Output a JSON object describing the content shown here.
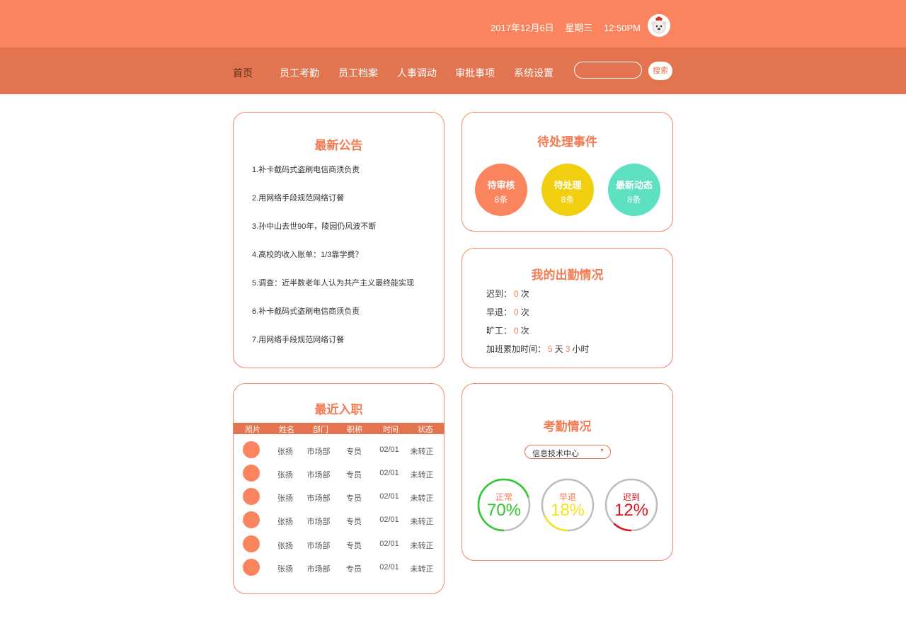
{
  "header": {
    "date": "2017年12月6日",
    "weekday": "星期三",
    "time": "12:50PM"
  },
  "nav": {
    "items": [
      "首页",
      "员工考勤",
      "员工档案",
      "人事调动",
      "审批事项",
      "系统设置"
    ],
    "search_label": "搜索"
  },
  "notices": {
    "title": "最新公告",
    "items": [
      "1.补卡截码式盗刷电信商须负责",
      "2.用网络手段规范网络订餐",
      "3.孙中山去世90年，陵园仍风波不断",
      "4.高校的收入账单：1/3靠学费？",
      "5.调查：近半数老年人认为共产主义最终能实现",
      "6.补卡截码式盗刷电信商须负责",
      "7.用网络手段规范网络订餐"
    ]
  },
  "pending": {
    "title": "待处理事件",
    "items": [
      {
        "label": "待审核",
        "count": "8条",
        "color": "#f9845d"
      },
      {
        "label": "待处理",
        "count": "8条",
        "color": "#f0cf10"
      },
      {
        "label": "最新动态",
        "count": "8条",
        "color": "#5ee0c3"
      }
    ]
  },
  "my_attendance": {
    "title": "我的出勤情况",
    "late_label": "迟到：",
    "late_value": "0",
    "early_label": "早退：",
    "early_value": "0",
    "absent_label": "旷工：",
    "absent_value": "0",
    "overtime_label": "加班累加时间：",
    "overtime_days": "5",
    "overtime_hours": "3",
    "times_unit": "次",
    "days_unit": "天",
    "hours_unit": "小时"
  },
  "recent_hires": {
    "title": "最近入职",
    "columns": [
      "照片",
      "姓名",
      "部门",
      "职称",
      "时间",
      "状态"
    ],
    "rows": [
      {
        "name": "张扬",
        "dept": "市场部",
        "title": "专员",
        "date": "02/01",
        "status": "未转正"
      },
      {
        "name": "张扬",
        "dept": "市场部",
        "title": "专员",
        "date": "02/01",
        "status": "未转正"
      },
      {
        "name": "张扬",
        "dept": "市场部",
        "title": "专员",
        "date": "02/01",
        "status": "未转正"
      },
      {
        "name": "张扬",
        "dept": "市场部",
        "title": "专员",
        "date": "02/01",
        "status": "未转正"
      },
      {
        "name": "张扬",
        "dept": "市场部",
        "title": "专员",
        "date": "02/01",
        "status": "未转正"
      },
      {
        "name": "张扬",
        "dept": "市场部",
        "title": "专员",
        "date": "02/01",
        "status": "未转正"
      }
    ]
  },
  "attendance_stats": {
    "title": "考勤情况",
    "department": "信息技术中心",
    "stats": [
      {
        "label": "正常",
        "percent": "70%",
        "value": 0.7,
        "color": "#2ec82e",
        "label_color": "#f47b52"
      },
      {
        "label": "早退",
        "percent": "18%",
        "value": 0.18,
        "color": "#f4e41a",
        "label_color": "#f47b52"
      },
      {
        "label": "迟到",
        "percent": "12%",
        "value": 0.12,
        "color": "#d9141f",
        "label_color": "#d9141f"
      }
    ]
  }
}
